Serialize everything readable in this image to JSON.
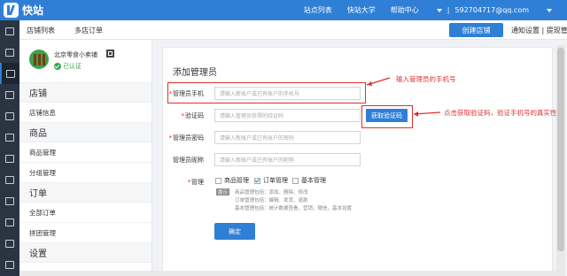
{
  "app": {
    "name": "快站"
  },
  "topnav": {
    "links": [
      "站点列表",
      "快站大学",
      "帮助中心"
    ],
    "user": "592704717@qq.com"
  },
  "subnav": {
    "tabs": [
      "店铺列表",
      "多店订单"
    ],
    "create_store": "创建店铺",
    "notice": "通知设置",
    "withdraw": "提现管"
  },
  "store": {
    "name": "北京零食小卖铺",
    "status": "已认证"
  },
  "sidebar": {
    "groups": [
      {
        "title": "店铺",
        "items": [
          "店铺信息"
        ]
      },
      {
        "title": "商品",
        "items": [
          "商品管理",
          "分组管理"
        ]
      },
      {
        "title": "订单",
        "items": [
          "全部订单",
          "拼团管理"
        ]
      },
      {
        "title": "设置",
        "items": []
      }
    ]
  },
  "form": {
    "title": "添加管理员",
    "phone": {
      "label": "管理员手机",
      "placeholder": "请输入新账户或已有账户的手机号"
    },
    "code": {
      "label": "验证码",
      "placeholder": "请输入管理员获得的验证码",
      "button": "获取验证码"
    },
    "password": {
      "label": "管理员密码",
      "placeholder": "请输入新账户或已有账户的密码"
    },
    "nickname": {
      "label": "管理员昵称",
      "placeholder": "请输入新账户或已有账户的昵称"
    },
    "permissions": {
      "label": "管理",
      "options": [
        {
          "label": "商品管理",
          "checked": false
        },
        {
          "label": "订单管理",
          "checked": true
        },
        {
          "label": "基本管理",
          "checked": false
        }
      ],
      "tip_badge": "提示",
      "help": [
        "商品管理包括：添加、删除、修改",
        "订单管理包括：编辑、发货、退款",
        "基本管理包括：统计数据查看，营销，微信，基本设置"
      ]
    },
    "submit": "确定"
  },
  "annotations": {
    "phone_note": "输入管理员的手机号",
    "code_note": "点击获取验证码，验证手机号的真实性"
  },
  "colors": {
    "primary": "#2f7fd6",
    "annotation": "#e03030",
    "rail": "#2b3442"
  }
}
